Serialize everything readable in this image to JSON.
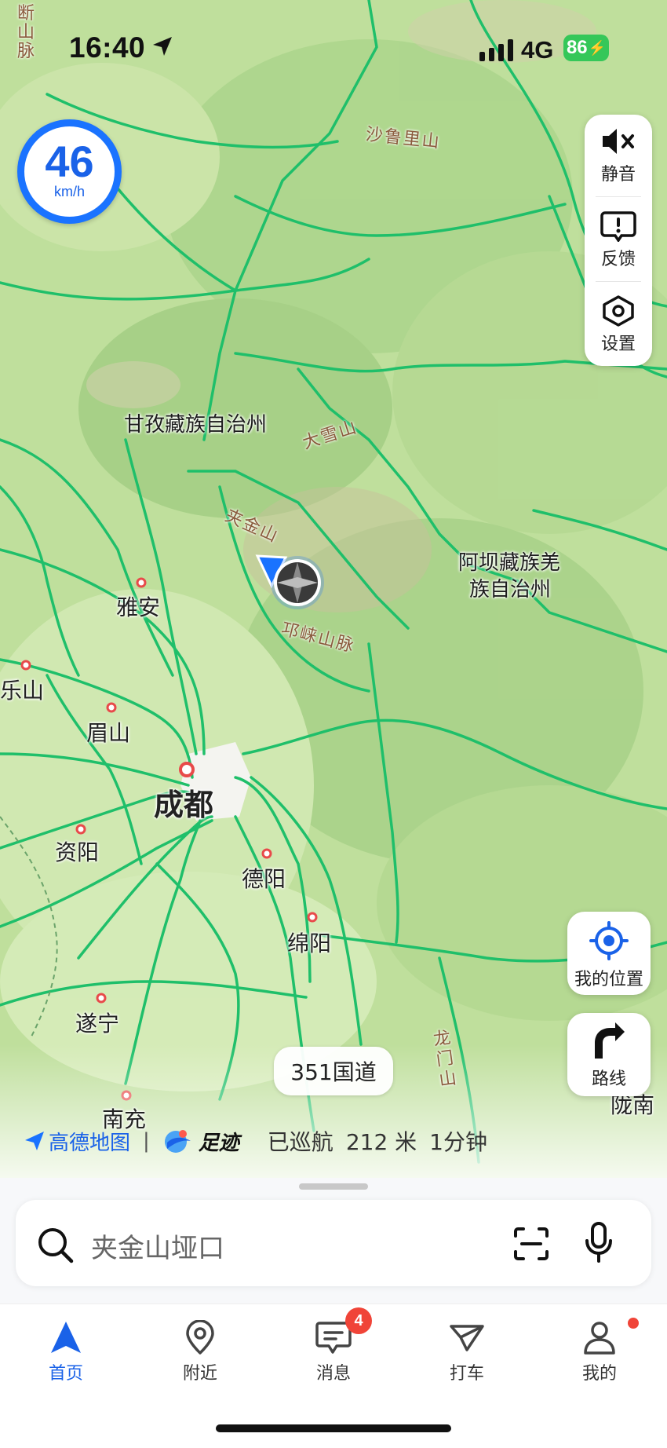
{
  "status_bar": {
    "time": "16:40",
    "network": "4G",
    "battery": "86"
  },
  "speed": {
    "value": "46",
    "unit": "km/h"
  },
  "side_controls": {
    "mute": "静音",
    "feedback": "反馈",
    "settings": "设置"
  },
  "my_location_label": "我的位置",
  "route_label": "路线",
  "road_pill": "351国道",
  "map_labels": {
    "duan_shanmai": "断\n山\n脉",
    "shaluli": "沙鲁里山",
    "daxueshan": "大雪山",
    "jiajinshan": "夹金山",
    "qionglai": "邛崃山脉",
    "ganzi": "甘孜藏族自治州",
    "aba_line1": "阿坝藏族羌",
    "aba_line2": "族自治州",
    "yaan": "雅安",
    "leshan": "乐山",
    "meishan": "眉山",
    "chengdu": "成都",
    "ziyang": "资阳",
    "deyang": "德阳",
    "mianyang": "绵阳",
    "suining": "遂宁",
    "nanchong": "南充",
    "longmenshan": "龙门山",
    "longnan": "陇南"
  },
  "brand_row": {
    "amap": "高德地图",
    "divider": "|",
    "zuji": "足迹",
    "cruise_text": "已巡航",
    "distance": "212 米",
    "duration": "1分钟"
  },
  "search": {
    "placeholder": "夹金山垭口"
  },
  "tabs": [
    {
      "label": "首页"
    },
    {
      "label": "附近"
    },
    {
      "label": "消息"
    },
    {
      "label": "打车"
    },
    {
      "label": "我的"
    }
  ],
  "messages_badge": "4",
  "colors": {
    "accent": "#1a62e8",
    "road": "#1fbf6a",
    "badge": "#f04438",
    "battery": "#35c759"
  }
}
